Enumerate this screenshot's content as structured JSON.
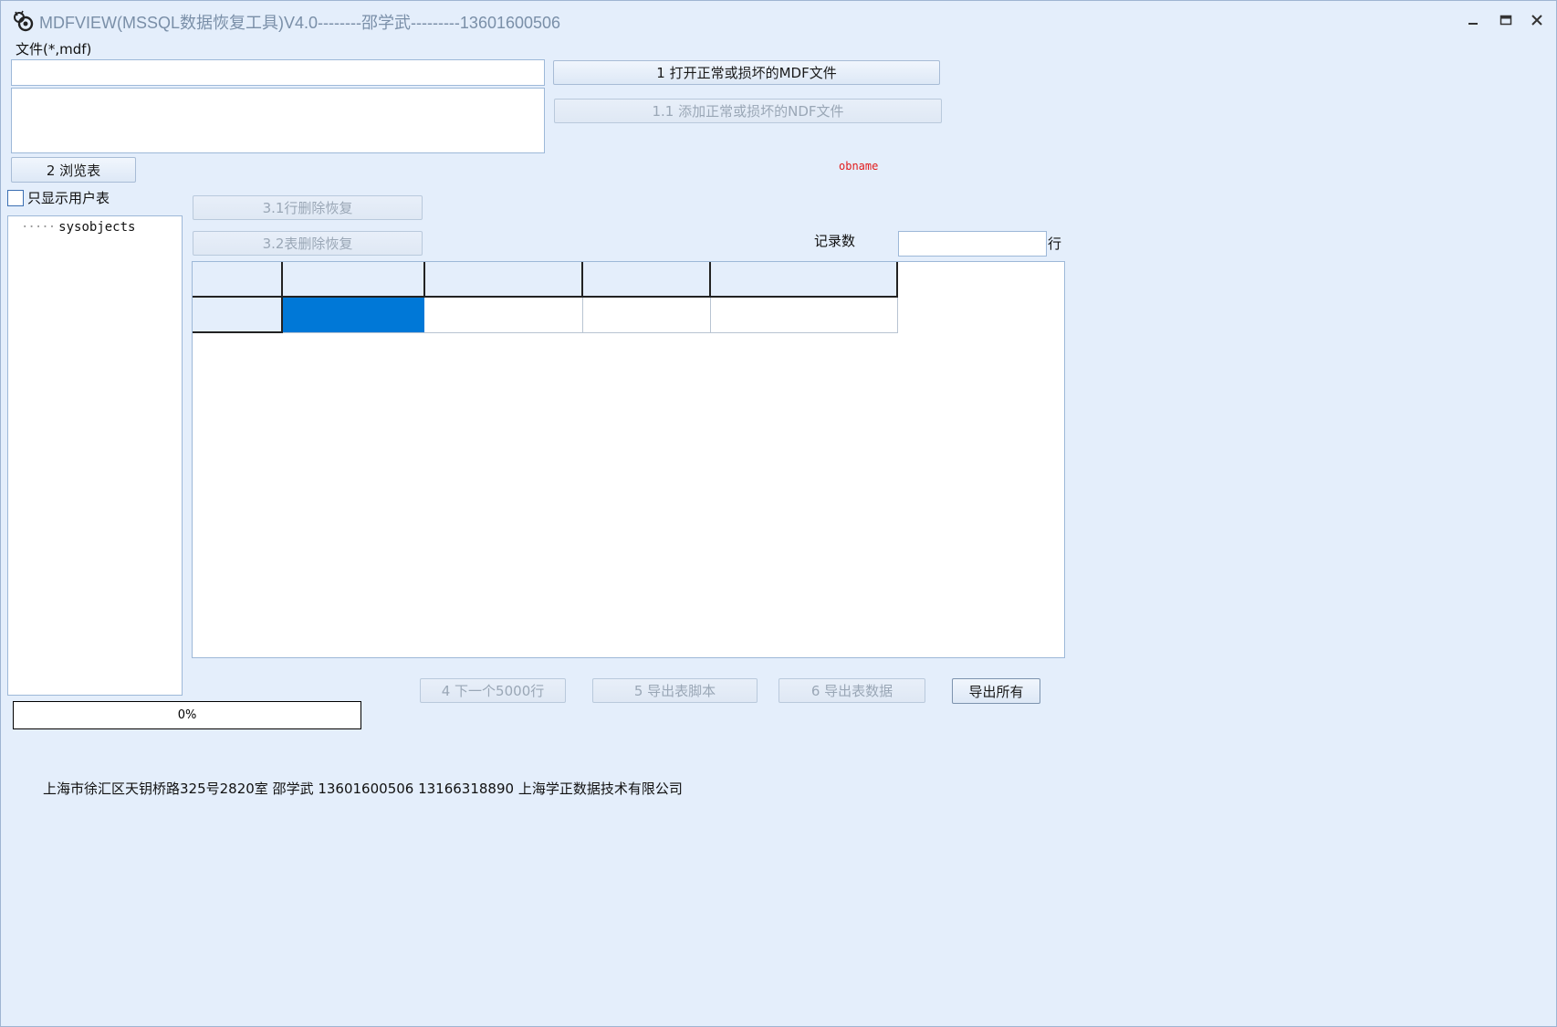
{
  "window": {
    "title": "MDFVIEW(MSSQL数据恢复工具)V4.0--------邵学武---------13601600506"
  },
  "file": {
    "label": "文件(*,mdf)",
    "value": "",
    "open_button": "1 打开正常或损坏的MDF文件",
    "add_ndf_button": "1.1 添加正常或损坏的NDF文件"
  },
  "browse": {
    "button": "2 浏览表",
    "user_tables_only": "只显示用户表",
    "user_tables_checked": false
  },
  "objname": "obname",
  "tree": {
    "items": [
      {
        "label": "sysobjects"
      }
    ]
  },
  "recover": {
    "row_delete": "3.1行删除恢复",
    "table_delete": "3.2表删除恢复"
  },
  "records": {
    "label": "记录数",
    "value": "",
    "suffix": "行"
  },
  "actions": {
    "next_5000": "4 下一个5000行",
    "export_script": "5 导出表脚本",
    "export_data": "6 导出表数据",
    "export_all": "导出所有"
  },
  "progress": {
    "value": 0,
    "text": "0%"
  },
  "footer": "上海市徐汇区天钥桥路325号2820室 邵学武 13601600506 13166318890  上海学正数据技术有限公司",
  "colors": {
    "background": "#e4eefb",
    "selected_cell": "#0078d7",
    "objname_text": "#e21b1b"
  }
}
